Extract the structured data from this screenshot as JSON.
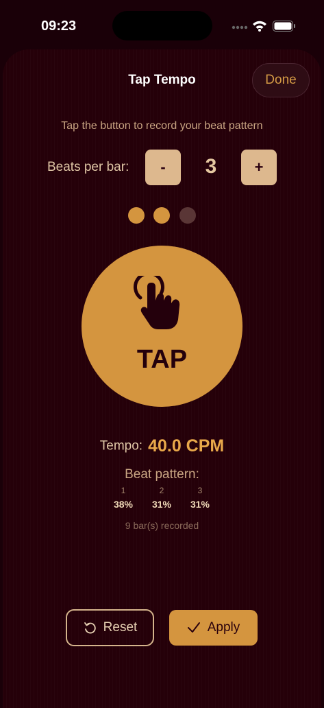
{
  "status": {
    "time": "09:23"
  },
  "header": {
    "title": "Tap Tempo",
    "done_label": "Done"
  },
  "instruction": "Tap the button to record your beat pattern",
  "beats_per_bar": {
    "label": "Beats per bar:",
    "minus_label": "-",
    "plus_label": "+",
    "value": "3"
  },
  "beat_indicators": {
    "total": 3,
    "active": 2
  },
  "tap": {
    "label": "TAP",
    "icon": "tap-hand-icon"
  },
  "tempo": {
    "label": "Tempo:",
    "value": "40.0 CPM"
  },
  "pattern": {
    "title": "Beat pattern:",
    "beats": [
      {
        "num": "1",
        "pct": "38%"
      },
      {
        "num": "2",
        "pct": "31%"
      },
      {
        "num": "3",
        "pct": "31%"
      }
    ],
    "bars_recorded": "9 bar(s) recorded"
  },
  "actions": {
    "reset_label": "Reset",
    "apply_label": "Apply"
  },
  "colors": {
    "accent": "#d4953f",
    "background": "#250009",
    "stepper": "#ddb88e"
  }
}
